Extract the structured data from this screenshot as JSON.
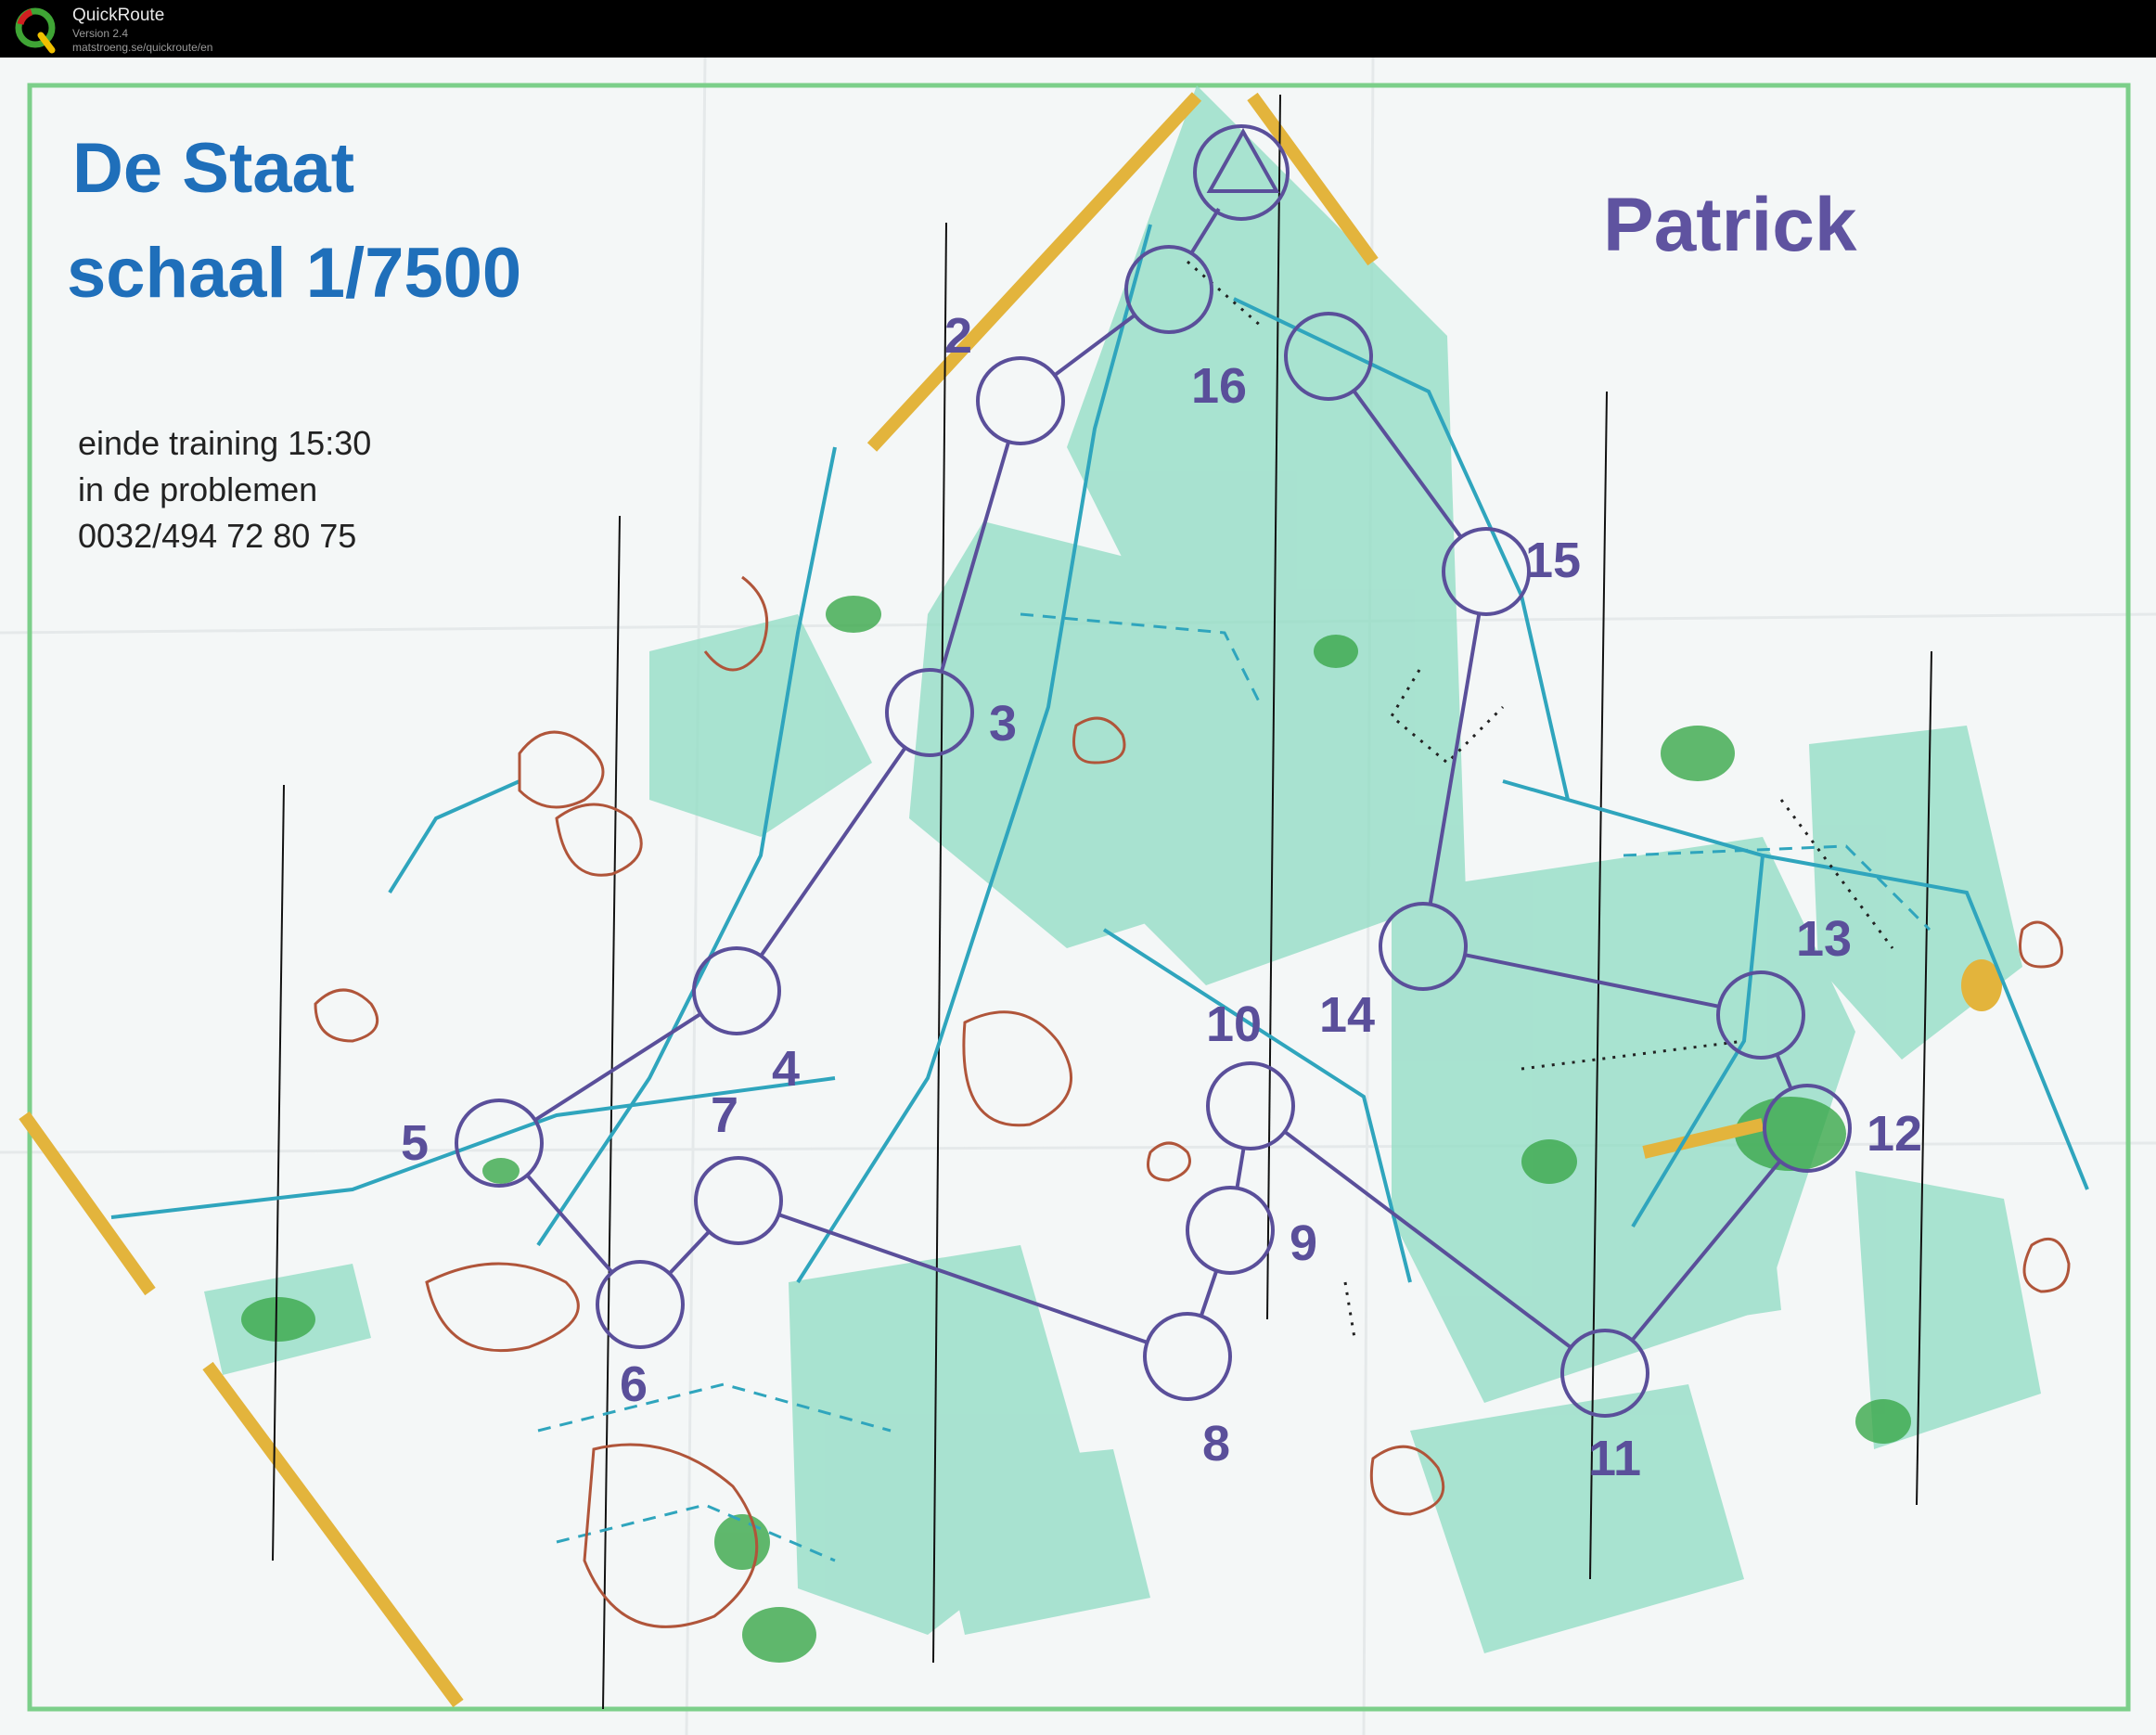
{
  "app": {
    "name": "QuickRoute",
    "version": "Version 2.4",
    "url": "matstroeng.se/quickroute/en",
    "logo_letter": "Q",
    "logo_icon": "quickroute-q-logo"
  },
  "map": {
    "title_line1": "De Staat",
    "title_line2": "schaal 1/7500",
    "runner_name": "Patrick",
    "info_lines": [
      "einde training 15:30",
      "in de problemen",
      "0032/494 72 80 75"
    ],
    "controls": [
      "2",
      "3",
      "4",
      "5",
      "6",
      "7",
      "8",
      "9",
      "10",
      "11",
      "12",
      "13",
      "14",
      "15",
      "16"
    ],
    "colors": {
      "course": "#5a4f9a",
      "title_blue": "#1f6fba",
      "runner_purple": "#5f53a0",
      "vegetation": "#7fd9bf",
      "dense_vegetation": "#3aa84a",
      "contours": "#b0553a",
      "paths": "#2fa5bd",
      "out_of_bounds": "#e3b43c",
      "frame": "#7ccf8a"
    }
  }
}
